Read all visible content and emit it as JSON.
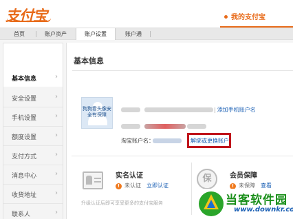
{
  "header": {
    "logo_text": "支付宝",
    "my_alipay": "我的支付宝"
  },
  "nav": {
    "items": [
      {
        "label": "首页"
      },
      {
        "label": "账户资产"
      },
      {
        "label": "账户设置"
      },
      {
        "label": "账户通"
      }
    ],
    "active_index": 2
  },
  "sidebar": {
    "items": [
      {
        "label": "基本信息"
      },
      {
        "label": "安全设置"
      },
      {
        "label": "手机设置"
      },
      {
        "label": "额度设置"
      },
      {
        "label": "支付方式"
      },
      {
        "label": "消息中心"
      },
      {
        "label": "收货地址"
      },
      {
        "label": "联系人"
      }
    ],
    "active_index": 0
  },
  "main": {
    "title": "基本信息",
    "avatar_overlay": "狗狗看头像安全有保障",
    "add_phone_link": "添加手机账户名",
    "taobao_label": "淘宝账户名：",
    "unbind_link": "解绑或更换账户",
    "cards": [
      {
        "title": "实名认证",
        "status": "未认证",
        "action": "立即认证",
        "sub": "升级认证后即可享受更多的支付宝服务"
      },
      {
        "title": "会员保障",
        "status": "未保障",
        "action": "查看",
        "icon_char": "保"
      }
    ]
  },
  "watermark": {
    "title": "当客软件园",
    "url": "www.downkr.com"
  },
  "colors": {
    "brand": "#e86b1a",
    "link": "#1a5fb4",
    "highlight_box": "#c0141b",
    "warn": "#f07a1e",
    "watermark_green": "#1a8f1a"
  }
}
